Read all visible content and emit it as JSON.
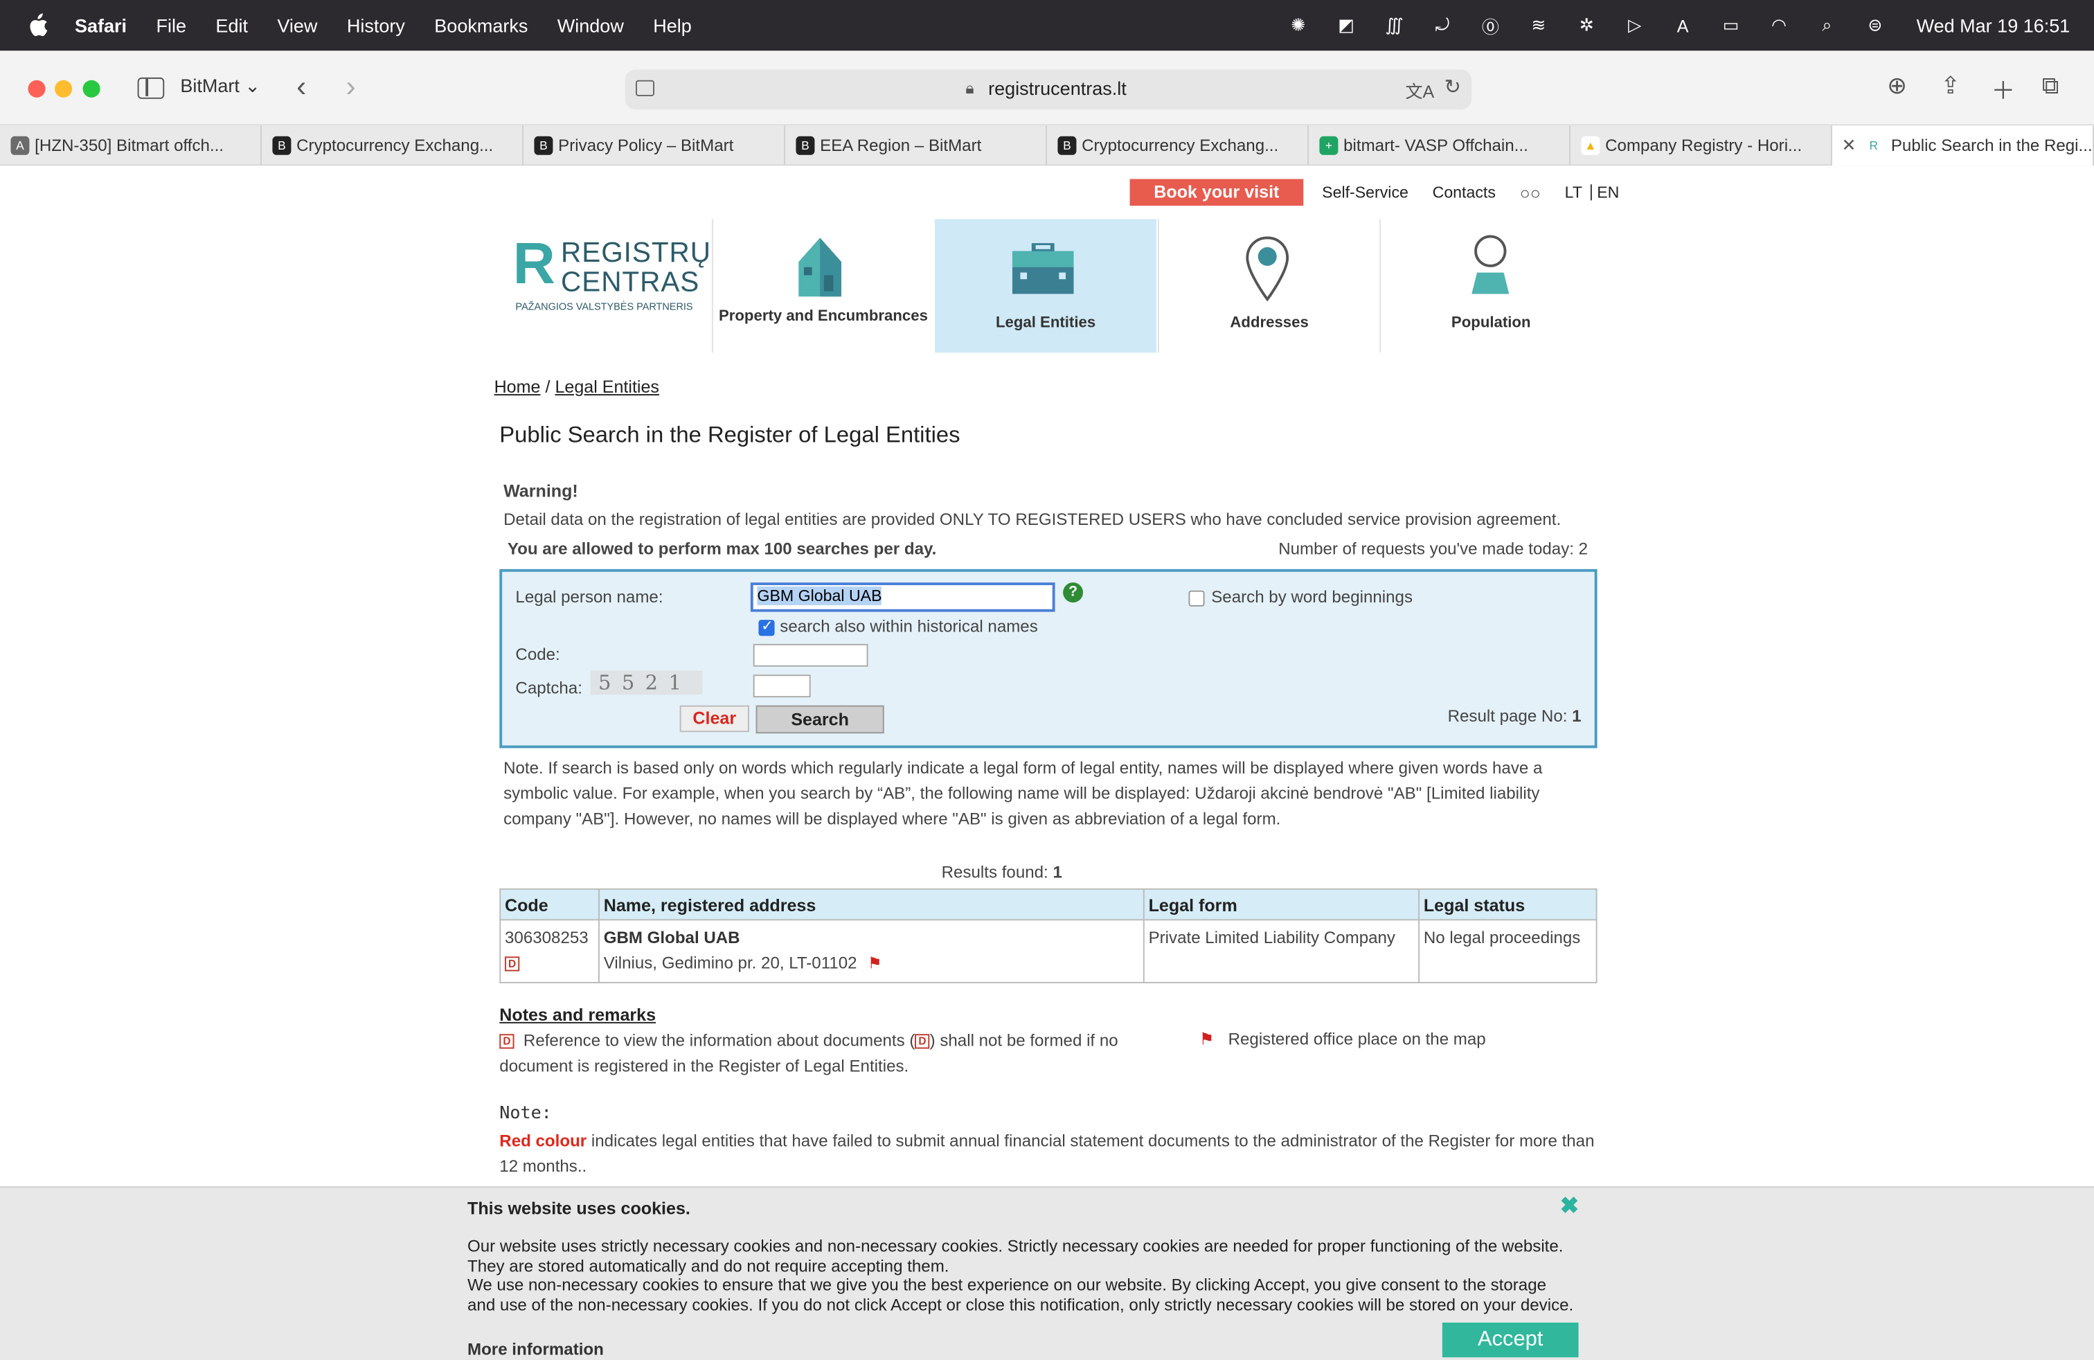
{
  "menubar": {
    "app": "Safari",
    "items": [
      "File",
      "Edit",
      "View",
      "History",
      "Bookmarks",
      "Window",
      "Help"
    ],
    "clock": "Wed Mar 19  16:51"
  },
  "toolbar": {
    "profile": "BitMart",
    "url": "registrucentras.lt"
  },
  "tabs": [
    {
      "label": "[HZN-350] Bitmart offch...",
      "fav": "A"
    },
    {
      "label": "Cryptocurrency Exchang...",
      "fav": "B"
    },
    {
      "label": "Privacy Policy – BitMart",
      "fav": "B"
    },
    {
      "label": "EEA Region – BitMart",
      "fav": "B"
    },
    {
      "label": "Cryptocurrency Exchang...",
      "fav": "B"
    },
    {
      "label": "bitmart- VASP Offchain...",
      "fav": "+"
    },
    {
      "label": "Company Registry - Hori...",
      "fav": "▲"
    },
    {
      "label": "Public Search in the Regi...",
      "fav": "R"
    }
  ],
  "topnav": {
    "book": "Book your visit",
    "self_service": "Self-Service",
    "contacts": "Contacts",
    "lt": "LT",
    "en": "EN"
  },
  "logo": {
    "line1": "REGISTRŲ",
    "line2": "CENTRAS",
    "tagline": "PAŽANGIOS VALSTYBĖS PARTNERIS"
  },
  "nav": {
    "property": "Property and Encumbrances",
    "legal": "Legal Entities",
    "addresses": "Addresses",
    "population": "Population"
  },
  "breadcrumb": {
    "home": "Home",
    "sep": "/",
    "current": "Legal Entities"
  },
  "page_title": "Public Search in the Register of Legal Entities",
  "warning": {
    "heading": "Warning!",
    "text": "Detail data on the registration of legal entities are provided ONLY TO REGISTERED USERS who have concluded service provision agreement.",
    "allowed": "You are allowed to perform max 100 searches per day.",
    "requests": "Number of requests you've made today: 2"
  },
  "search": {
    "name_label": "Legal person name:",
    "name_value": "GBM Global UAB",
    "historical_label": "search also within historical names",
    "historical_checked": true,
    "word_beginnings_label": "Search by word beginnings",
    "word_beginnings_checked": false,
    "code_label": "Code:",
    "captcha_label": "Captcha:",
    "captcha_text": "5521",
    "clear": "Clear",
    "search": "Search",
    "result_page_label": "Result page No:",
    "result_page": "1"
  },
  "note": "Note. If search is based only on words which regularly indicate a legal form of legal entity, names will be displayed where given words have a symbolic value. For example, when you search by “AB”, the following name will be displayed: Uždaroji akcinė bendrovė \"AB\" [Limited liability company \"AB\"]. However, no names will be displayed where \"AB\" is given as abbreviation of a legal form.",
  "results": {
    "label": "Results found:",
    "count": "1",
    "headers": [
      "Code",
      "Name, registered address",
      "Legal form",
      "Legal status"
    ],
    "rows": [
      {
        "code": "306308253",
        "name": "GBM Global UAB",
        "address": "Vilnius, Gedimino pr. 20, LT-01102",
        "legal_form": "Private Limited Liability Company",
        "legal_status": "No legal proceedings"
      }
    ]
  },
  "notes_remarks": {
    "heading": "Notes and remarks",
    "doc_text_a": "Reference to view the information about documents (",
    "doc_text_b": ") shall not be formed if no document is registered in the Register of Legal Entities.",
    "flag_text": "Registered office place on the map"
  },
  "note2": {
    "heading": "Note:",
    "red": "Red colour",
    "text": " indicates legal entities that have failed to submit annual financial statement documents to the administrator of the Register for more than 12 months.."
  },
  "cookie": {
    "heading": "This website uses cookies.",
    "p1": "Our website uses strictly necessary cookies and non-necessary cookies. Strictly necessary cookies are needed for proper functioning of the website. They are stored automatically and do not require accepting them.",
    "p2": "We use non-necessary cookies to ensure that we give you the best experience on our website. By clicking Accept, you give consent to the storage and use of the non-necessary cookies. If you do not click Accept or close this notification, only strictly necessary cookies will be stored on your device.",
    "more": "More information",
    "accept": "Accept"
  },
  "colors": {
    "accent": "#4a9bc2",
    "book": "#e85b4f",
    "accept": "#31b89c",
    "red_text": "#e1271c"
  }
}
